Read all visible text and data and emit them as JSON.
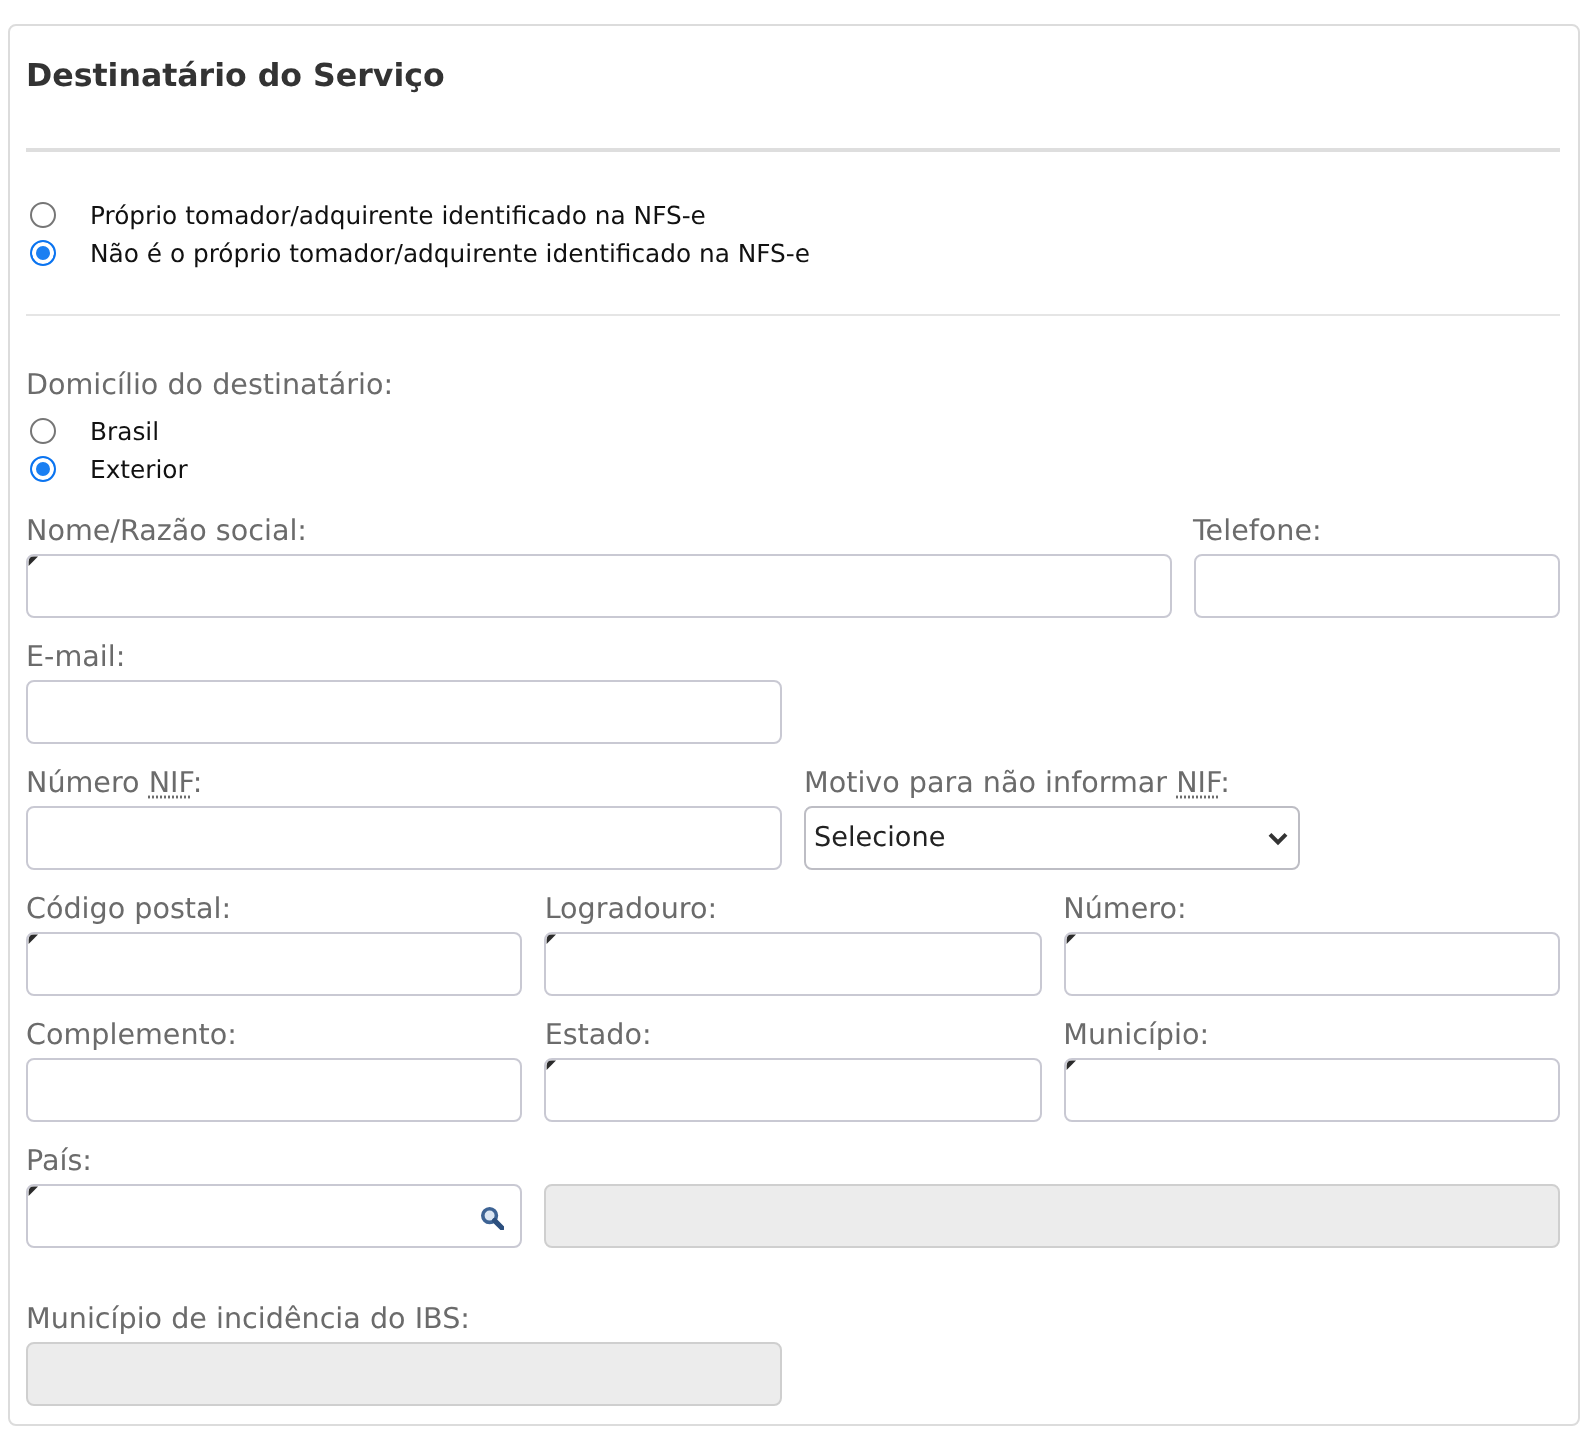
{
  "section": {
    "title": "Destinatário do Serviço"
  },
  "recipient_options": [
    {
      "label": "Próprio tomador/adquirente identificado na NFS-e",
      "selected": false
    },
    {
      "label": "Não é o próprio tomador/adquirente identificado na NFS-e",
      "selected": true
    }
  ],
  "domicile": {
    "label": "Domicílio do destinatário:",
    "options": [
      {
        "label": "Brasil",
        "selected": false
      },
      {
        "label": "Exterior",
        "selected": true
      }
    ]
  },
  "field_rows": [
    [
      {
        "label": "Nome/Razão social:",
        "kind": "text",
        "required": true,
        "disabled": false
      },
      {
        "label": "Telefone:",
        "kind": "text",
        "required": false,
        "disabled": false
      }
    ],
    [
      {
        "label": "E-mail:",
        "kind": "text",
        "required": false,
        "disabled": false
      }
    ],
    [
      {
        "label": "Número",
        "abbr": "NIF",
        "label_end": ":",
        "kind": "text",
        "required": false,
        "disabled": false
      },
      {
        "label": "Motivo para não informar",
        "abbr": "NIF",
        "label_end": ":",
        "kind": "select",
        "value": "Selecione",
        "required": false,
        "disabled": false
      }
    ],
    [
      {
        "label": "Código postal:",
        "kind": "text",
        "required": true,
        "disabled": false
      },
      {
        "label": "Logradouro:",
        "kind": "text",
        "required": true,
        "disabled": false
      },
      {
        "label": "Número:",
        "kind": "text",
        "required": true,
        "disabled": false
      }
    ],
    [
      {
        "label": "Complemento:",
        "kind": "text",
        "required": false,
        "disabled": false
      },
      {
        "label": "Estado:",
        "kind": "text",
        "required": true,
        "disabled": false
      },
      {
        "label": "Município:",
        "kind": "text",
        "required": true,
        "disabled": false
      }
    ],
    [
      {
        "label": "País:",
        "kind": "lookup",
        "required": true,
        "disabled": false
      },
      {
        "kind": "text",
        "required": false,
        "disabled": true
      }
    ],
    [
      {
        "label": "Município de incidência do IBS:",
        "kind": "text",
        "required": false,
        "disabled": true
      }
    ]
  ]
}
